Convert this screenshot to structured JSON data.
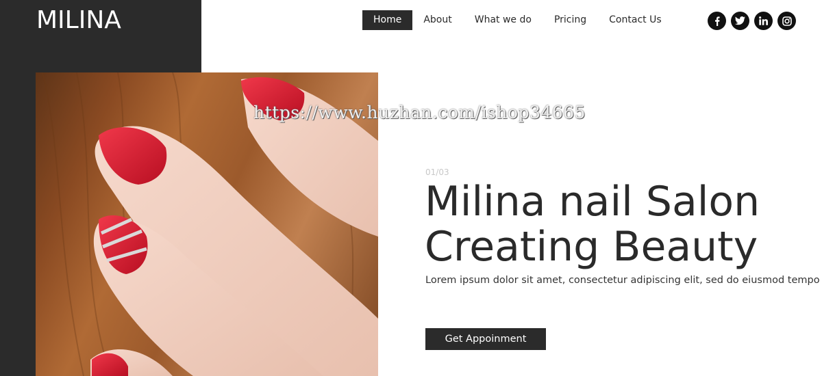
{
  "brand": {
    "logo_text": "MILINA"
  },
  "nav": {
    "items": [
      {
        "label": "Home",
        "active": true
      },
      {
        "label": "About"
      },
      {
        "label": "What we do"
      },
      {
        "label": "Pricing"
      },
      {
        "label": "Contact Us"
      }
    ]
  },
  "socials": [
    {
      "icon": "facebook-icon"
    },
    {
      "icon": "twitter-icon"
    },
    {
      "icon": "linkedin-icon"
    },
    {
      "icon": "instagram-icon"
    }
  ],
  "hero": {
    "slide_counter": "01/03",
    "title_line1": "Milina nail Salon",
    "title_line2": "Creating Beauty",
    "subtitle": "Lorem ipsum dolor sit amet, consectetur adipiscing elit, sed do eiusmod tempo",
    "cta_label": "Get Appoinment"
  },
  "watermark": "https://www.huzhan.com/ishop34665",
  "colors": {
    "dark": "#2b2b2b",
    "nail_red": "#d4162a",
    "text": "#2a2a2a"
  }
}
